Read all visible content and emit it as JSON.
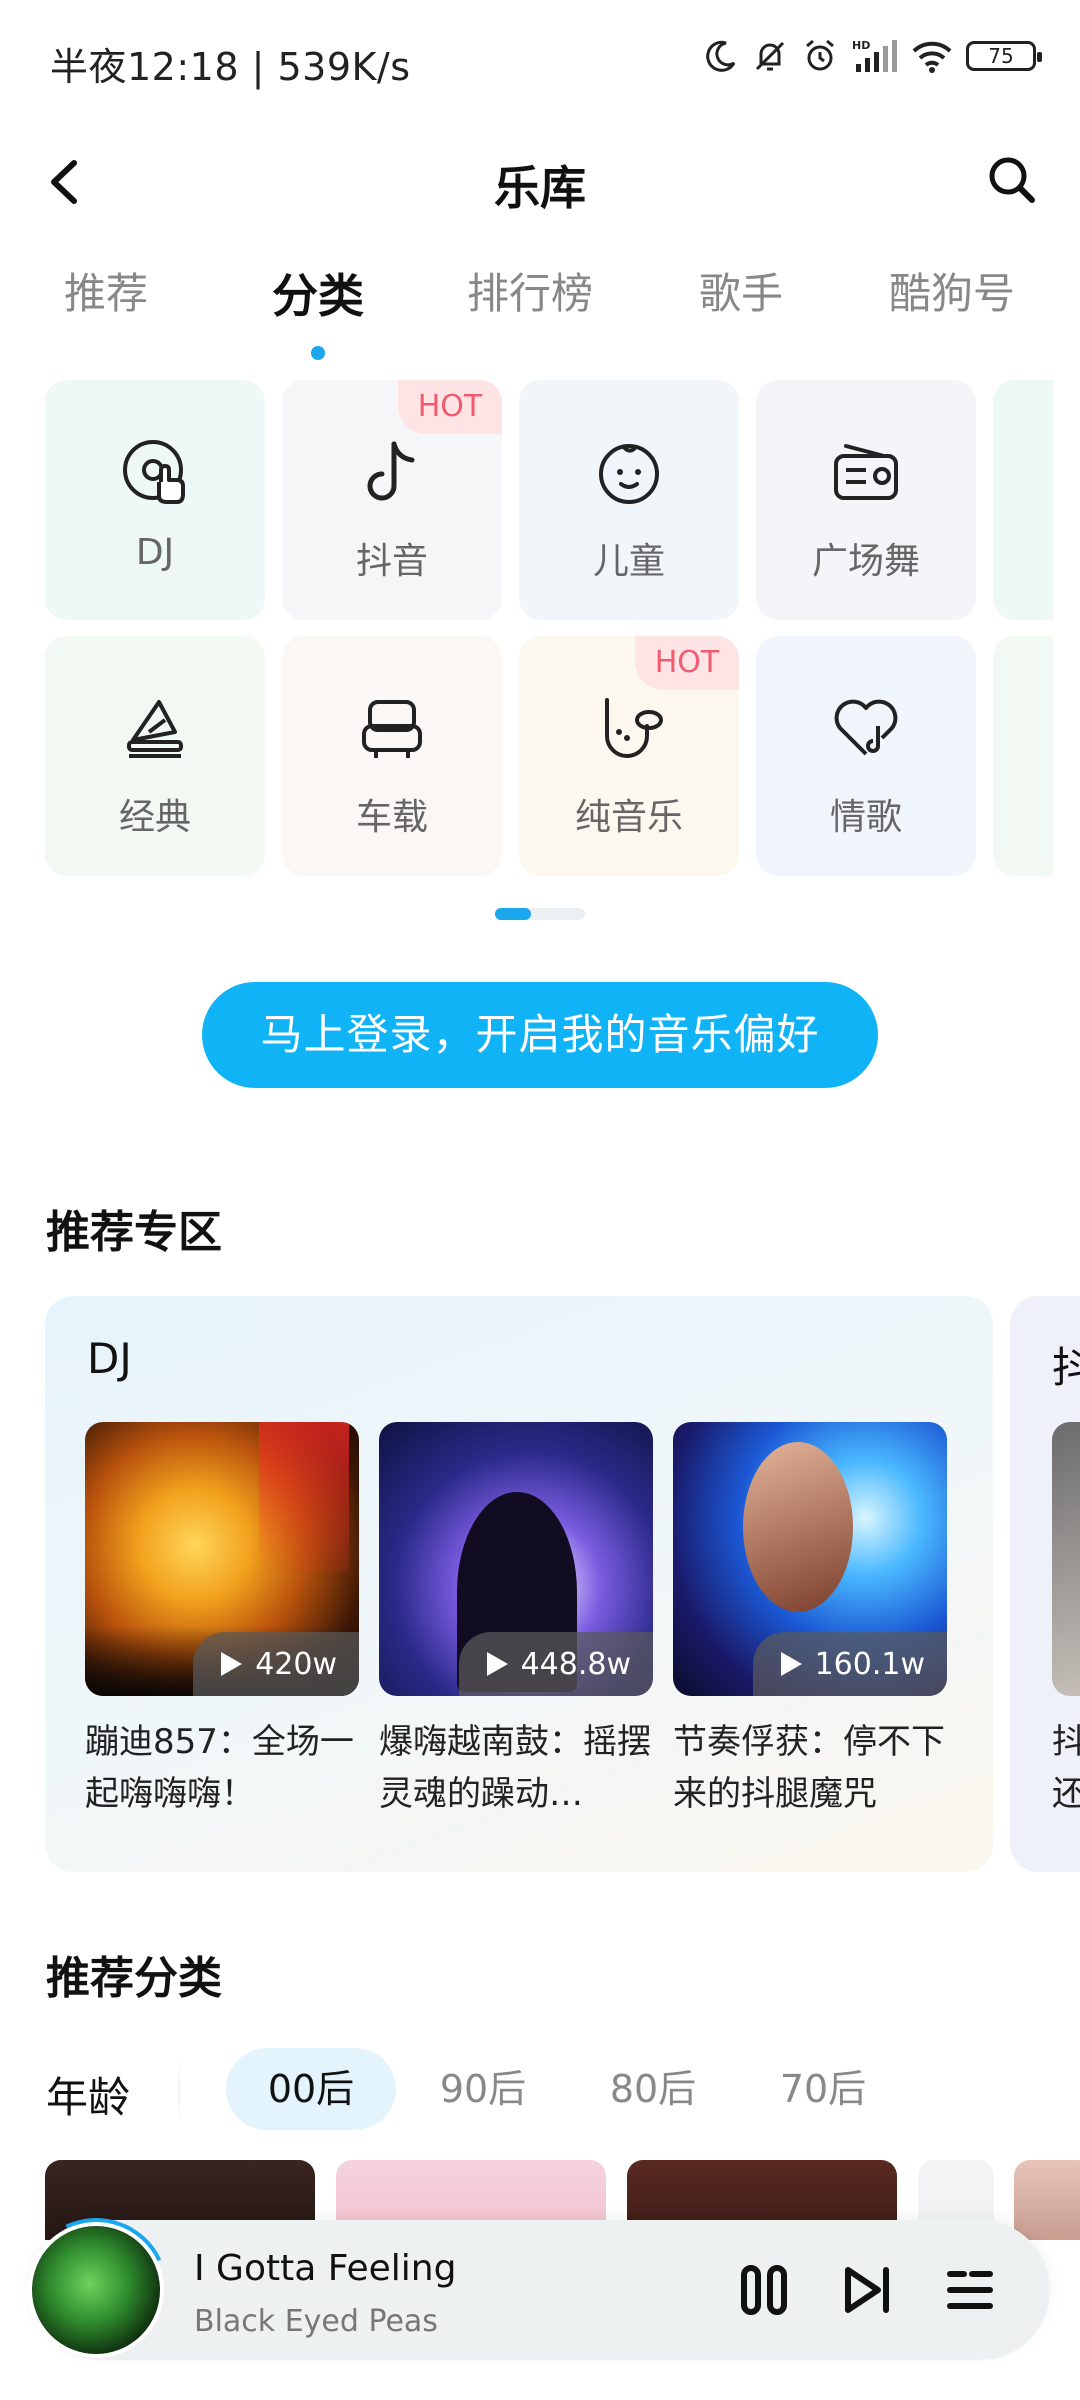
{
  "status_bar": {
    "time_speed": "半夜12:18 | 539K/s",
    "battery": "75",
    "network_label": "HD"
  },
  "header": {
    "title": "乐库"
  },
  "tabs": [
    {
      "label": "推荐",
      "active": false
    },
    {
      "label": "分类",
      "active": true
    },
    {
      "label": "排行榜",
      "active": false
    },
    {
      "label": "歌手",
      "active": false
    },
    {
      "label": "酷狗号",
      "active": false
    }
  ],
  "categories": [
    {
      "label": "DJ",
      "icon": "dj-disc-icon",
      "hot": false,
      "bg": "#eef8f6"
    },
    {
      "label": "抖音",
      "icon": "tiktok-note-icon",
      "hot": true,
      "bg": "#f6f5f8"
    },
    {
      "label": "儿童",
      "icon": "baby-face-icon",
      "hot": false,
      "bg": "#f1f6fb"
    },
    {
      "label": "广场舞",
      "icon": "radio-icon",
      "hot": false,
      "bg": "#f4f4f9"
    },
    {
      "label": "经典",
      "icon": "gramophone-icon",
      "hot": false,
      "bg": "#f2f8f2"
    },
    {
      "label": "车载",
      "icon": "car-seat-icon",
      "hot": false,
      "bg": "#fbf7f4"
    },
    {
      "label": "纯音乐",
      "icon": "saxophone-icon",
      "hot": true,
      "bg": "#fdf8ef"
    },
    {
      "label": "情歌",
      "icon": "heart-note-icon",
      "hot": false,
      "bg": "#f1f6fc"
    }
  ],
  "hot_badge": "HOT",
  "login_button": "马上登录，开启我的音乐偏好",
  "recommend_zone": {
    "title": "推荐专区",
    "card_title": "DJ",
    "items": [
      {
        "name": "蹦迪857：全场一起嗨嗨嗨！",
        "plays": "420w"
      },
      {
        "name": "爆嗨越南鼓：摇摆灵魂的躁动…",
        "plays": "448.8w"
      },
      {
        "name": "节奏俘获：停不下来的抖腿魔咒",
        "plays": "160.1w"
      }
    ],
    "next_card_title": "抖",
    "next_card_text": "抖还"
  },
  "recommend_category": {
    "title": "推荐分类",
    "age_label": "年龄",
    "age_chips": [
      {
        "label": "00后",
        "active": true
      },
      {
        "label": "90后",
        "active": false
      },
      {
        "label": "80后",
        "active": false
      },
      {
        "label": "70后",
        "active": false
      }
    ]
  },
  "player": {
    "title": "I Gotta Feeling",
    "artist": "Black Eyed Peas"
  },
  "colors": {
    "accent": "#10b3f5",
    "hot_text": "#f25a6d",
    "hot_bg": "#ffe4e6"
  }
}
